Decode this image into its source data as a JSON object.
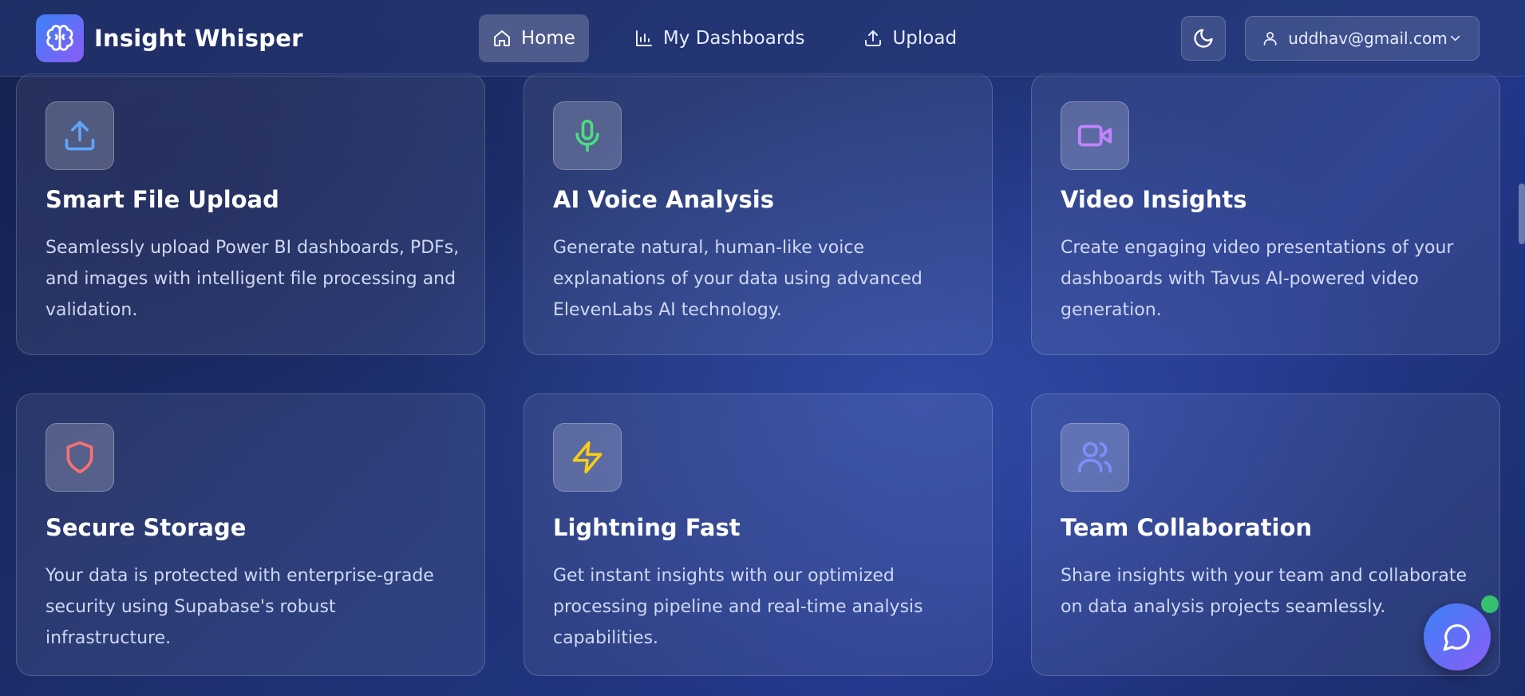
{
  "header": {
    "app_name": "Insight Whisper",
    "nav": [
      {
        "label": "Home",
        "icon": "home-icon",
        "active": true
      },
      {
        "label": "My Dashboards",
        "icon": "bar-chart-icon",
        "active": false
      },
      {
        "label": "Upload",
        "icon": "upload-icon",
        "active": false
      }
    ],
    "theme_toggle_icon": "moon-icon",
    "user": {
      "email": "uddhav@gmail.com",
      "icon": "user-icon",
      "dropdown_icon": "chevron-down-icon"
    }
  },
  "features": [
    {
      "title": "Smart File Upload",
      "description": "Seamlessly upload Power BI dashboards, PDFs, and images with intelligent file processing and validation.",
      "icon": "upload-icon",
      "icon_color": "#60a5fa"
    },
    {
      "title": "AI Voice Analysis",
      "description": "Generate natural, human-like voice explanations of your data using advanced ElevenLabs AI technology.",
      "icon": "microphone-icon",
      "icon_color": "#4ade80"
    },
    {
      "title": "Video Insights",
      "description": "Create engaging video presentations of your dashboards with Tavus AI-powered video generation.",
      "icon": "video-icon",
      "icon_color": "#c084fc"
    },
    {
      "title": "Secure Storage",
      "description": "Your data is protected with enterprise-grade security using Supabase's robust infrastructure.",
      "icon": "shield-icon",
      "icon_color": "#f87171"
    },
    {
      "title": "Lightning Fast",
      "description": "Get instant insights with our optimized processing pipeline and real-time analysis capabilities.",
      "icon": "lightning-icon",
      "icon_color": "#facc15"
    },
    {
      "title": "Team Collaboration",
      "description": "Share insights with your team and collaborate on data analysis projects seamlessly.",
      "icon": "users-icon",
      "icon_color": "#818cf8"
    }
  ],
  "chat": {
    "icon": "chat-icon",
    "status_color": "#34c26f"
  },
  "colors": {
    "accent_gradient_start": "#3b82f6",
    "accent_gradient_end": "#8b5cf6"
  }
}
